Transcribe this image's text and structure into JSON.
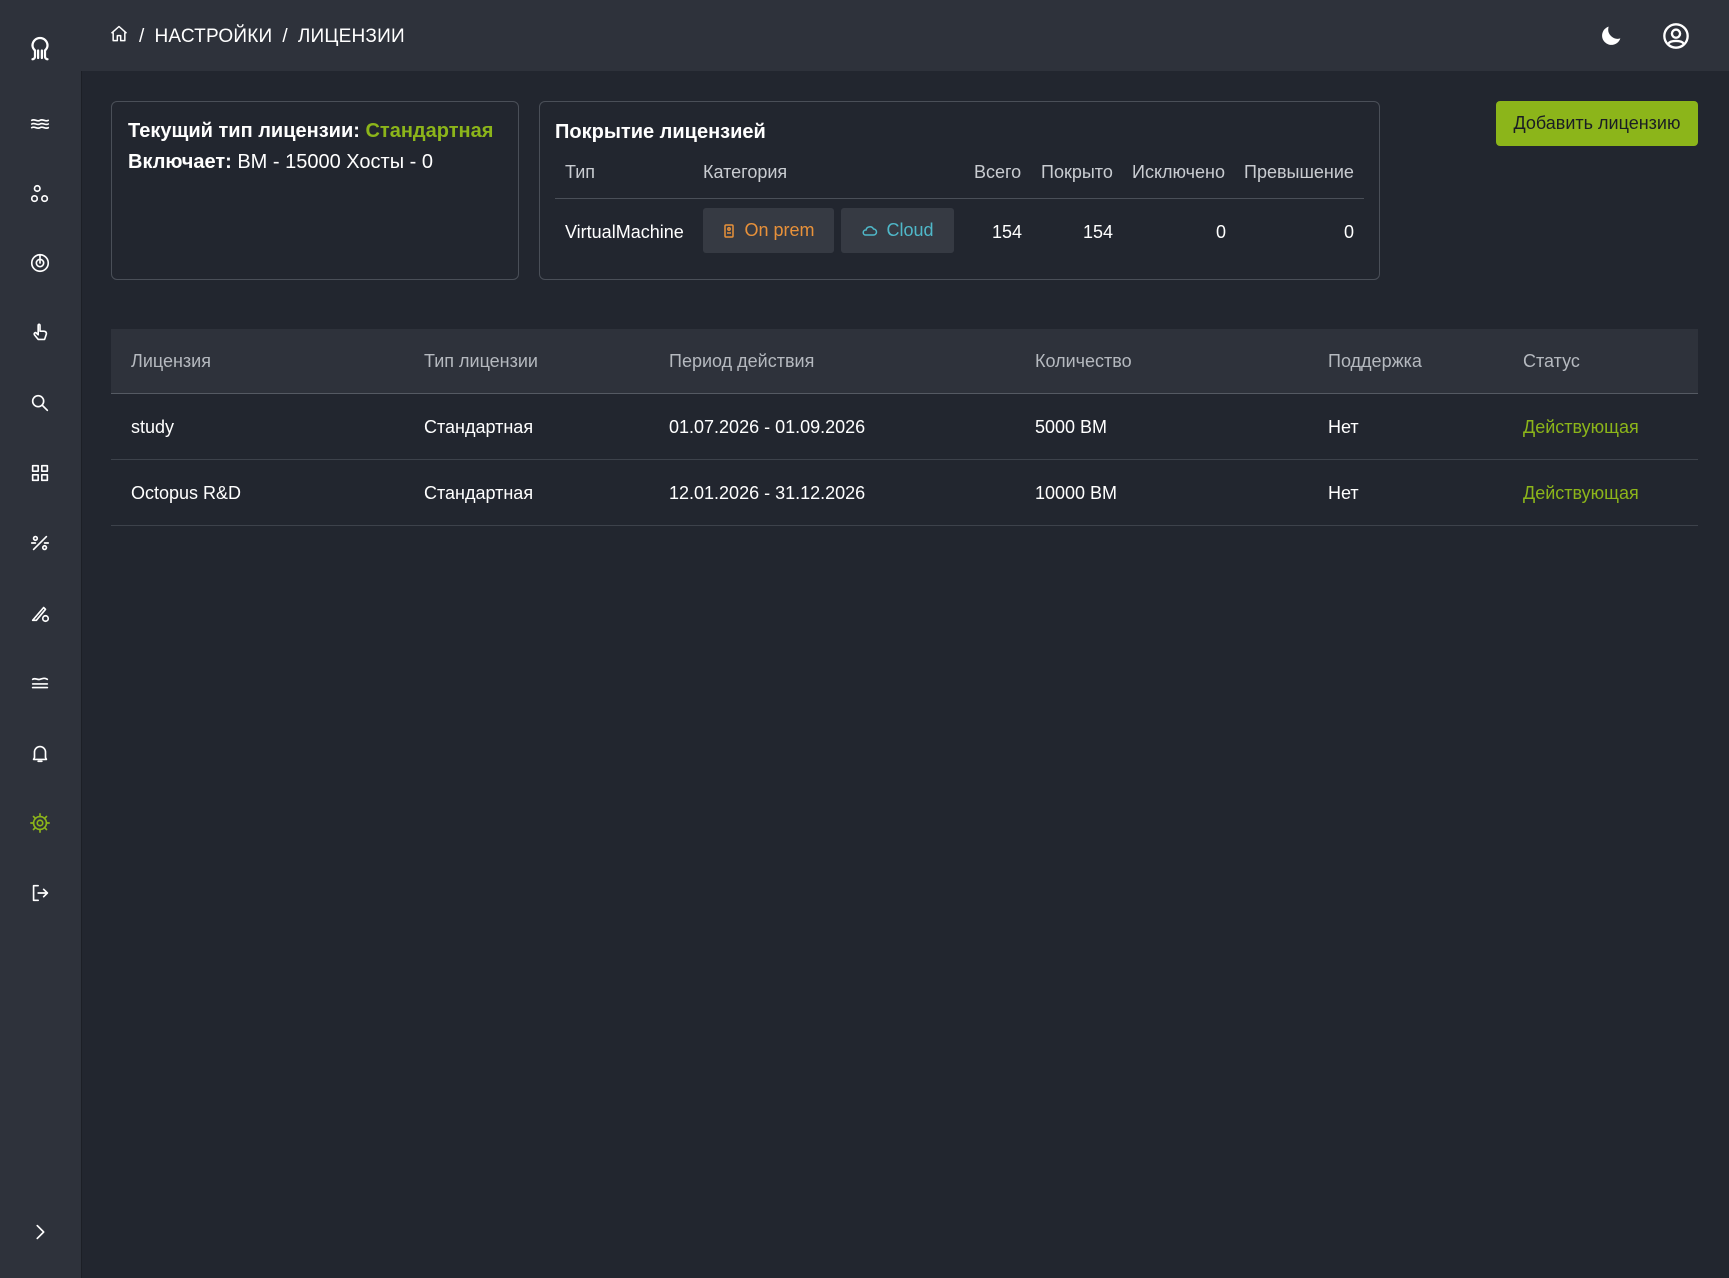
{
  "breadcrumb": {
    "items": [
      "НАСТРОЙКИ",
      "ЛИЦЕНЗИИ"
    ]
  },
  "sidebar": {
    "icons": [
      "octopus-logo-icon",
      "waves-icon",
      "nodes-icon",
      "radar-icon",
      "pointer-icon",
      "search-icon",
      "dashboard-icon",
      "percent-icon",
      "pen-settings-icon",
      "layers-icon",
      "bell-icon",
      "gear-icon",
      "logout-icon",
      "chevron-right-icon"
    ],
    "active": "gear-icon"
  },
  "license_info": {
    "type_label": "Текущий тип лицензии:",
    "type_value": "Стандартная",
    "includes_label": "Включает:",
    "includes_vm": "ВМ - 15000",
    "includes_hosts": "Хосты - 0"
  },
  "coverage": {
    "title": "Покрытие лицензией",
    "headers": [
      "Тип",
      "Категория",
      "Всего",
      "Покрыто",
      "Исключено",
      "Превышение"
    ],
    "row": {
      "type": "VirtualMachine",
      "categories": [
        "On prem",
        "Cloud"
      ],
      "total": "154",
      "covered": "154",
      "excluded": "0",
      "excess": "0"
    }
  },
  "actions": {
    "add_license": "Добавить лицензию"
  },
  "licenses_table": {
    "headers": [
      "Лицензия",
      "Тип лицензии",
      "Период действия",
      "Количество",
      "Поддержка",
      "Статус"
    ],
    "rows": [
      [
        "study",
        "Стандартная",
        "01.07.2026 - 01.09.2026",
        "5000 ВМ",
        "Нет",
        "Действующая"
      ],
      [
        "Octopus R&D",
        "Стандартная",
        "12.01.2026 - 31.12.2026",
        "10000 ВМ",
        "Нет",
        "Действующая"
      ]
    ]
  },
  "colors": {
    "accent": "#8cb51a",
    "onprem": "#e8913a",
    "cloud": "#4fb8c9",
    "background": "#22262f",
    "panel": "#2e323b"
  }
}
